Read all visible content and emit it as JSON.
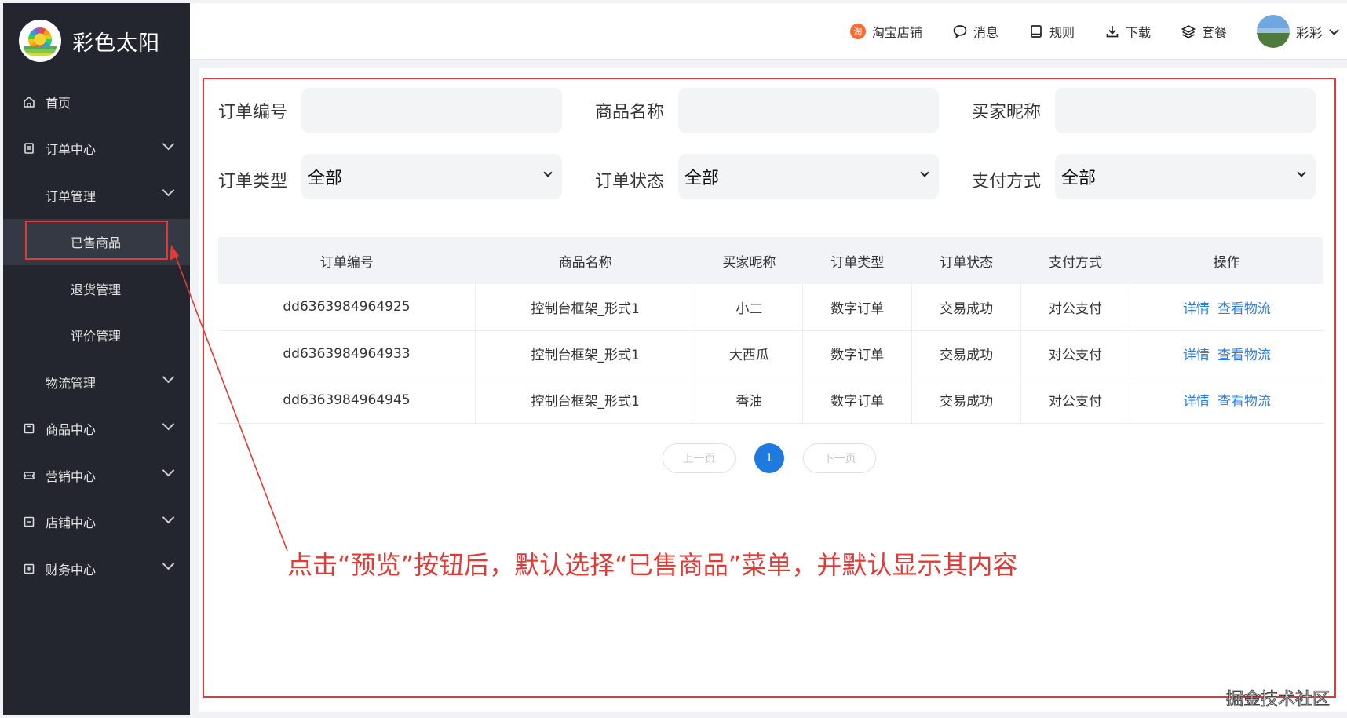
{
  "brand": {
    "name": "彩色太阳"
  },
  "sidebar": {
    "items": [
      {
        "label": "首页"
      },
      {
        "label": "订单中心"
      },
      {
        "label": "订单管理"
      },
      {
        "label": "已售商品"
      },
      {
        "label": "退货管理"
      },
      {
        "label": "评价管理"
      },
      {
        "label": "物流管理"
      },
      {
        "label": "商品中心"
      },
      {
        "label": "营销中心"
      },
      {
        "label": "店铺中心"
      },
      {
        "label": "财务中心"
      }
    ]
  },
  "header": {
    "taobao": "淘宝店铺",
    "taobao_icon_char": "淘",
    "messages": "消息",
    "rules": "规则",
    "download": "下载",
    "plans": "套餐",
    "user": "彩彩"
  },
  "filters": {
    "order_no_label": "订单编号",
    "product_name_label": "商品名称",
    "buyer_nick_label": "买家昵称",
    "order_type_label": "订单类型",
    "order_type_value": "全部",
    "order_status_label": "订单状态",
    "order_status_value": "全部",
    "pay_method_label": "支付方式",
    "pay_method_value": "全部"
  },
  "table": {
    "columns": [
      "订单编号",
      "商品名称",
      "买家昵称",
      "订单类型",
      "订单状态",
      "支付方式",
      "操作"
    ],
    "rows": [
      {
        "order_no": "dd6363984964925",
        "product": "控制台框架_形式1",
        "buyer": "小二",
        "type": "数字订单",
        "status": "交易成功",
        "pay": "对公支付"
      },
      {
        "order_no": "dd6363984964933",
        "product": "控制台框架_形式1",
        "buyer": "大西瓜",
        "type": "数字订单",
        "status": "交易成功",
        "pay": "对公支付"
      },
      {
        "order_no": "dd6363984964945",
        "product": "控制台框架_形式1",
        "buyer": "香油",
        "type": "数字订单",
        "status": "交易成功",
        "pay": "对公支付"
      }
    ],
    "action_detail": "详情",
    "action_logistics": "查看物流"
  },
  "pager": {
    "prev": "上一页",
    "current": "1",
    "next": "下一页"
  },
  "annotation": "点击“预览”按钮后，默认选择“已售商品”菜单，并默认显示其内容",
  "watermark": "掘金技术社区",
  "colors": {
    "sidebar_bg": "#23262e",
    "accent": "#1f7ae0",
    "annotation": "#e53935",
    "link": "#2f7de1"
  }
}
